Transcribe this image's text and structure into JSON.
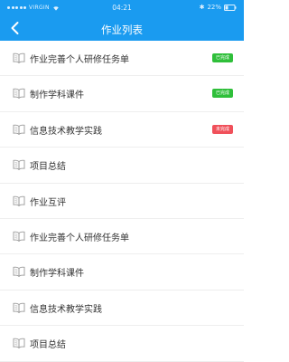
{
  "status_bar": {
    "carrier": "VIRGIN",
    "time": "04:21",
    "battery_text": "22%"
  },
  "header": {
    "title": "作业列表",
    "background": "#1a9bf0"
  },
  "list": [
    {
      "title": "作业完善个人研修任务单",
      "badge": {
        "text": "已完成",
        "color": "#2fbf3a"
      }
    },
    {
      "title": "制作学科课件",
      "badge": {
        "text": "已完成",
        "color": "#2fbf3a"
      }
    },
    {
      "title": "信息技术教学实践",
      "badge": {
        "text": "未完成",
        "color": "#f0505a"
      }
    },
    {
      "title": "项目总结",
      "badge": null
    },
    {
      "title": "作业互评",
      "badge": null
    },
    {
      "title": "作业完善个人研修任务单",
      "badge": null
    },
    {
      "title": "制作学科课件",
      "badge": null
    },
    {
      "title": "信息技术教学实践",
      "badge": null
    },
    {
      "title": "项目总结",
      "badge": null
    }
  ],
  "icons": {
    "row": "book-icon",
    "back": "back-chevron-icon"
  }
}
